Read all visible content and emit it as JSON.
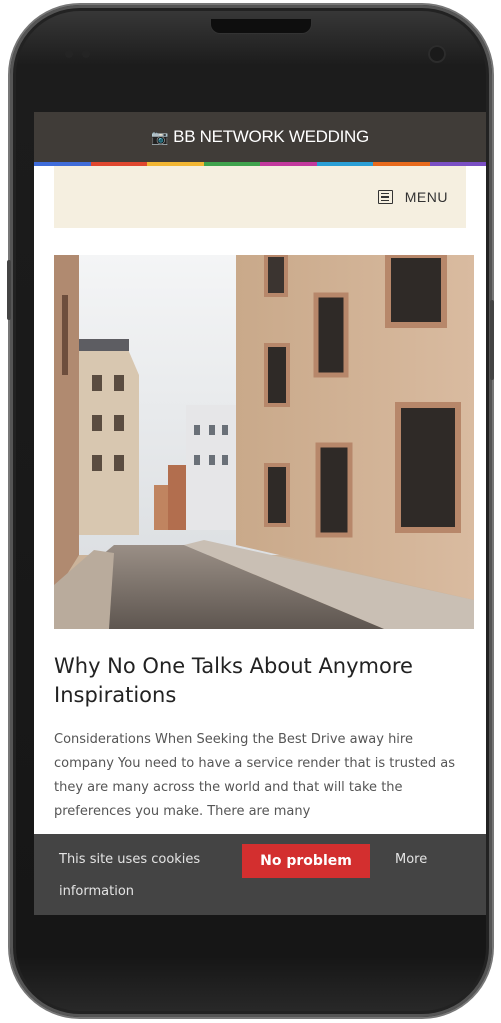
{
  "site": {
    "brand_icon": "camera-icon",
    "title": "BB NETWORK WEDDING",
    "stripe_colors": [
      "#3f6cd9",
      "#e0472f",
      "#f2b632",
      "#3fa34d",
      "#c3389e",
      "#2a9fd6",
      "#e86a1c",
      "#7a4fc4"
    ]
  },
  "nav": {
    "menu_icon": "menu-icon",
    "menu_label": "MENU"
  },
  "post": {
    "image_alt": "Cobblestone street between old buildings",
    "title": "Why No One Talks About Anymore Inspirations",
    "excerpt": "Considerations When Seeking the Best Drive away hire company You need to have a service render that is trusted as they are many across the world and that will take the preferences you make. There are many"
  },
  "cookie": {
    "text": "This site uses cookies",
    "button_label": "No problem",
    "more_label_1": "More",
    "more_label_2": "information"
  }
}
